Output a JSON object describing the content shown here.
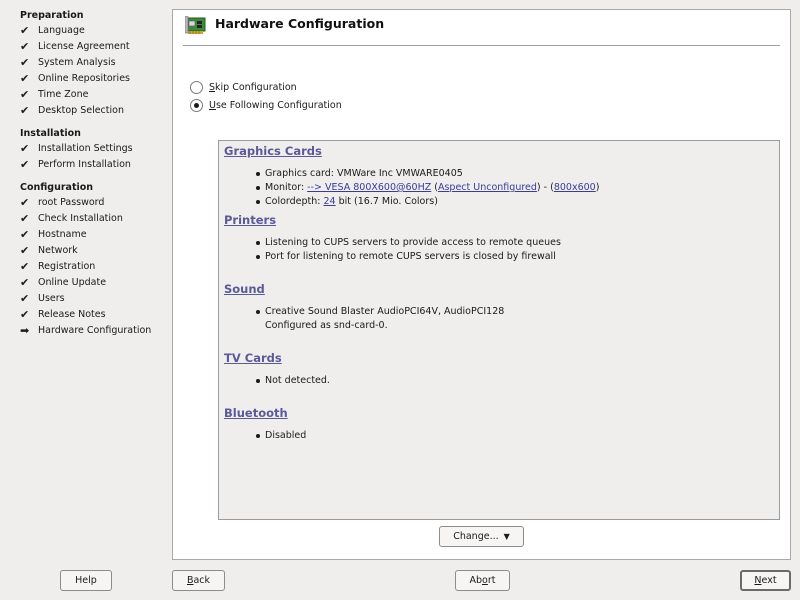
{
  "sidebar": {
    "sections": [
      {
        "title": "Preparation",
        "steps": [
          {
            "label": "Language",
            "status": "done"
          },
          {
            "label": "License Agreement",
            "status": "done"
          },
          {
            "label": "System Analysis",
            "status": "done"
          },
          {
            "label": "Online Repositories",
            "status": "done"
          },
          {
            "label": "Time Zone",
            "status": "done"
          },
          {
            "label": "Desktop Selection",
            "status": "done"
          }
        ]
      },
      {
        "title": "Installation",
        "steps": [
          {
            "label": "Installation Settings",
            "status": "done"
          },
          {
            "label": "Perform Installation",
            "status": "done"
          }
        ]
      },
      {
        "title": "Configuration",
        "steps": [
          {
            "label": "root Password",
            "status": "done"
          },
          {
            "label": "Check Installation",
            "status": "done"
          },
          {
            "label": "Hostname",
            "status": "done"
          },
          {
            "label": "Network",
            "status": "done"
          },
          {
            "label": "Registration",
            "status": "done"
          },
          {
            "label": "Online Update",
            "status": "done"
          },
          {
            "label": "Users",
            "status": "done"
          },
          {
            "label": "Release Notes",
            "status": "done"
          },
          {
            "label": "Hardware Configuration",
            "status": "current"
          }
        ]
      }
    ],
    "marks": {
      "done": "✔",
      "current": "➡"
    }
  },
  "main": {
    "title": "Hardware Configuration",
    "icon": "hardware-card-icon",
    "options": {
      "skip": {
        "ul": "S",
        "rest": "kip Configuration",
        "selected": false
      },
      "use": {
        "ul": "U",
        "rest": "se Following Configuration",
        "selected": true
      }
    },
    "summary": {
      "graphics": {
        "heading": "Graphics Cards",
        "card": "Graphics card: VMWare Inc VMWARE0405",
        "monitor_prefix": "Monitor: ",
        "monitor_link": "--> VESA 800X600@60HZ",
        "aspect_open": " (",
        "aspect_link": "Aspect Unconfigured",
        "aspect_close": ") - (",
        "res_link": "800x600",
        "res_close": ")",
        "depth_prefix": "Colordepth: ",
        "depth_link": "24",
        "depth_suffix": " bit (16.7 Mio. Colors)"
      },
      "printers": {
        "heading": "Printers",
        "items": [
          "Listening to CUPS servers to provide access to remote queues",
          "Port for listening to remote CUPS servers is closed by firewall"
        ]
      },
      "sound": {
        "heading": "Sound",
        "item": "Creative Sound Blaster AudioPCI64V, AudioPCI128",
        "item_cont": "Configured as snd-card-0."
      },
      "tv": {
        "heading": "TV Cards",
        "item": "Not detected."
      },
      "bluetooth": {
        "heading": "Bluetooth",
        "item": "Disabled"
      }
    },
    "change_button": "Change...",
    "change_caret": "▼"
  },
  "buttons": {
    "help": "Help",
    "back_ul": "B",
    "back_rest": "ack",
    "abort_pre": "Ab",
    "abort_ul": "o",
    "abort_rest": "rt",
    "next_ul": "N",
    "next_rest": "ext"
  },
  "colors": {
    "background": "#efeeec",
    "heading_link": "#5a5a98",
    "link": "#3b3b9a"
  }
}
